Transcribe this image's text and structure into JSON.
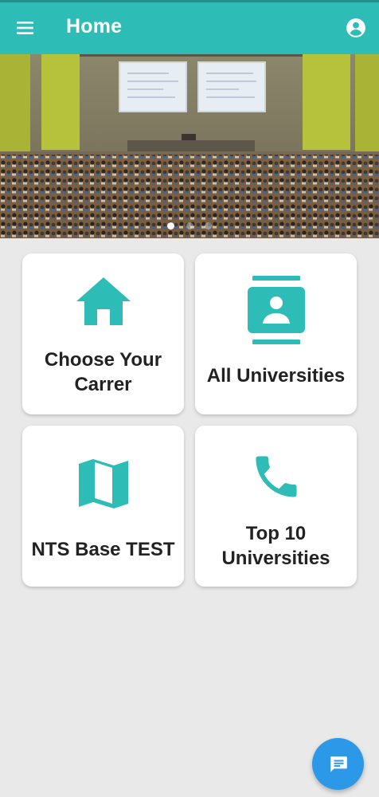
{
  "appbar": {
    "title": "Home",
    "menu_icon": "hamburger-menu-icon",
    "account_icon": "account-circle-icon"
  },
  "carousel": {
    "image": "lecture-hall-photo",
    "slide_count": 3,
    "active_index": 0
  },
  "cards": [
    {
      "label": "Choose Your Carrer",
      "icon": "home-icon"
    },
    {
      "label": "All Universities",
      "icon": "contacts-icon"
    },
    {
      "label": "NTS Base TEST",
      "icon": "map-icon"
    },
    {
      "label": "Top 10 Universities",
      "icon": "phone-icon"
    }
  ],
  "fab": {
    "icon": "chat-message-icon"
  },
  "colors": {
    "appbar": "#2dbdb6",
    "accent": "#2dbdb6",
    "background": "#e9e9e9",
    "fab": "#2c98e8"
  }
}
